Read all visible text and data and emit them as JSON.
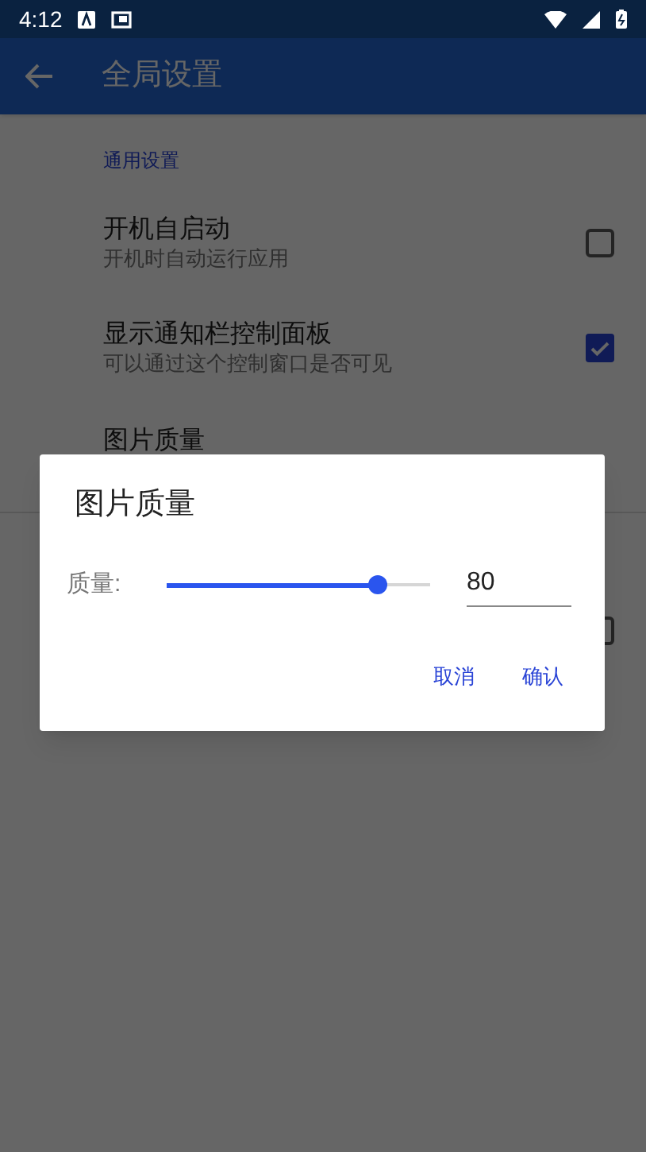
{
  "status_bar": {
    "time": "4:12"
  },
  "app_bar": {
    "title": "全局设置"
  },
  "section": {
    "header": "通用设置"
  },
  "settings": [
    {
      "kind": "checkbox",
      "title": "开机自启动",
      "summary": "开机时自动运行应用",
      "checked": false
    },
    {
      "kind": "checkbox",
      "title": "显示通知栏控制面板",
      "summary": "可以通过这个控制窗口是否可见",
      "checked": true
    },
    {
      "kind": "plain",
      "title": "图片质量"
    }
  ],
  "hidden_section": {
    "checked": false
  },
  "dialog": {
    "title": "图片质量",
    "label": "质量:",
    "level": 0.8,
    "value": "80",
    "buttons": [
      "取消",
      "确认"
    ]
  }
}
